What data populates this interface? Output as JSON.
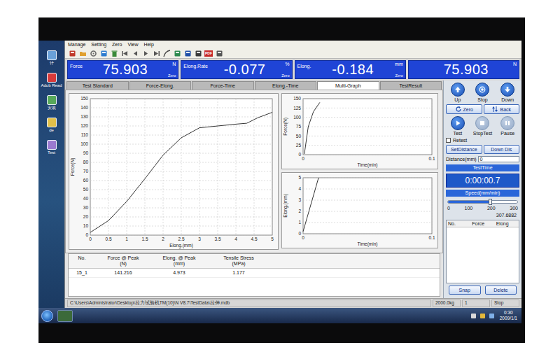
{
  "desktop": {
    "icons": [
      {
        "label": "计"
      },
      {
        "label": "Adob Read"
      },
      {
        "label": "安装"
      },
      {
        "label": "de"
      },
      {
        "label": "Test"
      }
    ]
  },
  "menu": [
    "Manage",
    "Setting",
    "Zero",
    "View",
    "Help"
  ],
  "toolbar": [
    {
      "kind": "tools"
    },
    {
      "kind": "open"
    },
    {
      "kind": "settings"
    },
    {
      "kind": "report"
    },
    {
      "kind": "delete"
    },
    {
      "kind": "first"
    },
    {
      "kind": "prev"
    },
    {
      "kind": "next"
    },
    {
      "kind": "last"
    },
    {
      "kind": "curve"
    },
    {
      "kind": "edit"
    },
    {
      "kind": "save"
    },
    {
      "kind": "print"
    },
    {
      "kind": "pdf",
      "label": "PDF"
    },
    {
      "kind": "exit"
    }
  ],
  "readouts": [
    {
      "label": "Force",
      "value": "75.903",
      "unit": "N",
      "zero": "Zero"
    },
    {
      "label": "Elong.Rate",
      "value": "-0.077",
      "unit": "%",
      "zero": "Zero"
    },
    {
      "label": "Elong.",
      "value": "-0.184",
      "unit": "mm",
      "zero": "Zero"
    },
    {
      "value": "75.903",
      "unit": "N"
    }
  ],
  "tabs": [
    {
      "label": "Test Standard",
      "selected": false
    },
    {
      "label": "Force-Elong.",
      "selected": false
    },
    {
      "label": "Force-Time",
      "selected": false
    },
    {
      "label": "Elong.-Time",
      "selected": false
    },
    {
      "label": "Multi-Graph",
      "selected": true
    },
    {
      "label": "TestResult",
      "selected": false
    }
  ],
  "main_chart": {
    "y_title": "Force(N)",
    "x_title": "Elong.(mm)",
    "y_ticks": [
      "0",
      "10",
      "20",
      "30",
      "40",
      "50",
      "60",
      "70",
      "80",
      "90",
      "100",
      "110",
      "120",
      "130",
      "140",
      "150"
    ],
    "x_ticks": [
      "0",
      "0.5",
      "1",
      "1.5",
      "2",
      "2.5",
      "3",
      "3.5",
      "4",
      "4.5",
      "5"
    ],
    "series": [
      {
        "x": [
          0,
          0.5,
          1,
          1.5,
          2,
          2.5,
          3,
          3.5,
          4,
          4.3,
          4.6,
          5
        ],
        "y": [
          3,
          16,
          37,
          62,
          88,
          107,
          118,
          120,
          122,
          123,
          129,
          135
        ]
      }
    ]
  },
  "force_time_chart": {
    "y_title": "Force(N)",
    "x_title": "Time(min)",
    "y_ticks": [
      "0",
      "25",
      "50",
      "75",
      "100",
      "125",
      "150"
    ],
    "x_ticks": [
      "0",
      "0.1"
    ],
    "series": [
      {
        "x": [
          0.001,
          0.004,
          0.008,
          0.013
        ],
        "y": [
          2,
          75,
          115,
          140
        ]
      }
    ]
  },
  "elong_time_chart": {
    "y_title": "Elong.(mm)",
    "x_title": "Time(min)",
    "y_ticks": [
      "0",
      "1",
      "2",
      "3",
      "4",
      "5"
    ],
    "x_ticks": [
      "0",
      "0.1"
    ],
    "series": [
      {
        "x": [
          0,
          0.012
        ],
        "y": [
          0.2,
          5
        ]
      }
    ]
  },
  "results": {
    "columns": [
      {
        "label": "No.",
        "unit": ""
      },
      {
        "label": "Force @ Peak",
        "unit": "(N)"
      },
      {
        "label": "Elong. @ Peak",
        "unit": "(mm)"
      },
      {
        "label": "Tensile Stress",
        "unit": "(MPa)"
      }
    ],
    "rows": [
      [
        "15_1",
        "141.216",
        "4.973",
        "1.177"
      ]
    ]
  },
  "controls": {
    "motion": [
      {
        "label": "Up",
        "kind": "up",
        "disabled": false
      },
      {
        "label": "Stop",
        "kind": "stop",
        "disabled": false
      },
      {
        "label": "Down",
        "kind": "down",
        "disabled": false
      }
    ],
    "zero_back": [
      {
        "label": "Zero",
        "kind": "zero"
      },
      {
        "label": "Back",
        "kind": "back"
      }
    ],
    "test": [
      {
        "label": "Test",
        "kind": "play",
        "disabled": false
      },
      {
        "label": "StopTest",
        "kind": "square",
        "disabled": true
      },
      {
        "label": "Pause",
        "kind": "pause",
        "disabled": true
      }
    ],
    "retest": {
      "label": "Retest",
      "checked": false
    },
    "distance_buttons": [
      "SetDistance",
      "Down Dis"
    ],
    "distance": {
      "label": "Distance(mm)",
      "value": "0"
    },
    "test_time": {
      "label": "TestTime",
      "value": "0:00:00.7"
    },
    "speed": {
      "label": "Speed(mm/min)",
      "level": 0.62,
      "ticks": [
        "0",
        "100",
        "200",
        "300"
      ],
      "reading": "307.6882"
    },
    "mini_table": {
      "columns": [
        "No.",
        "Force",
        "Elong"
      ]
    },
    "buttons": [
      "Snap",
      "Delete"
    ]
  },
  "status_bar": {
    "path": "C:\\Users\\Administrator\\Desktop\\拉力试验机TM(10)\\N V8.7\\TestData\\拉伸.mdb",
    "cells": [
      "2000.0kg",
      "1",
      "Stop"
    ]
  },
  "taskbar": {
    "time": "0:30",
    "date": "2009/1/1"
  }
}
